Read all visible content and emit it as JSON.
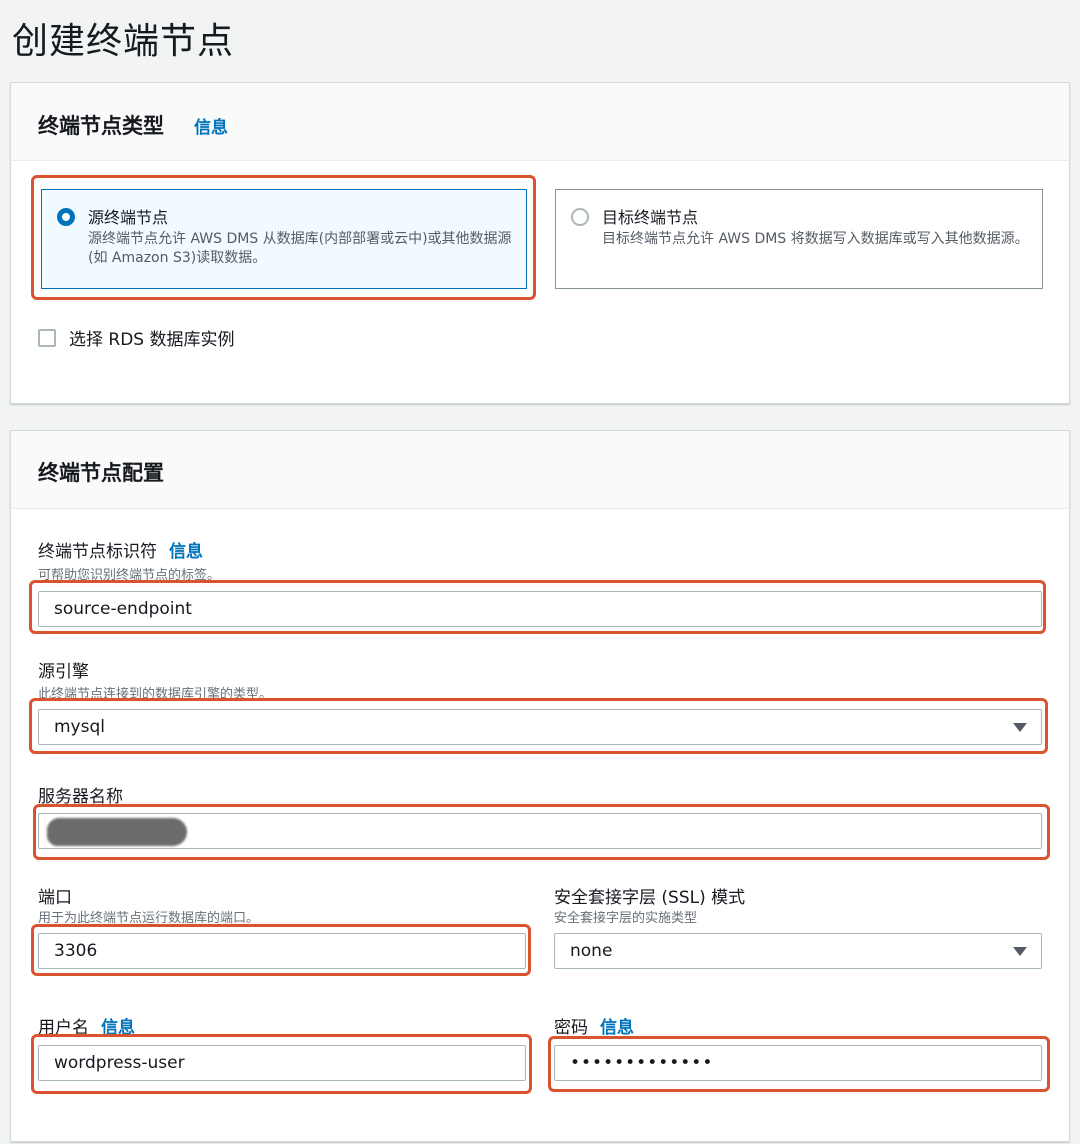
{
  "page": {
    "title": "创建终端节点"
  },
  "endpoint_type": {
    "title": "终端节点类型",
    "info": "信息",
    "options": [
      {
        "title": "源终端节点",
        "description": "源终端节点允许 AWS DMS 从数据库(内部部署或云中)或其他数据源(如 Amazon S3)读取数据。",
        "selected": true
      },
      {
        "title": "目标终端节点",
        "description": "目标终端节点允许 AWS DMS 将数据写入数据库或写入其他数据源。",
        "selected": false
      }
    ],
    "rds_checkbox": {
      "label": "选择 RDS 数据库实例",
      "checked": false
    }
  },
  "endpoint_config": {
    "title": "终端节点配置",
    "identifier": {
      "label": "终端节点标识符",
      "info": "信息",
      "description": "可帮助您识别终端节点的标签。",
      "value": "source-endpoint"
    },
    "engine": {
      "label": "源引擎",
      "description": "此终端节点连接到的数据库引擎的类型。",
      "value": "mysql"
    },
    "server": {
      "label": "服务器名称",
      "value": ""
    },
    "port": {
      "label": "端口",
      "description": "用于为此终端节点运行数据库的端口。",
      "value": "3306"
    },
    "ssl": {
      "label": "安全套接字层 (SSL) 模式",
      "description": "安全套接字层的实施类型",
      "value": "none"
    },
    "username": {
      "label": "用户名",
      "info": "信息",
      "value": "wordpress-user"
    },
    "password": {
      "label": "密码",
      "info": "信息",
      "value": "•••••••••••••"
    }
  },
  "colors": {
    "accent": "#0073bb",
    "highlight": "#d9532f"
  }
}
